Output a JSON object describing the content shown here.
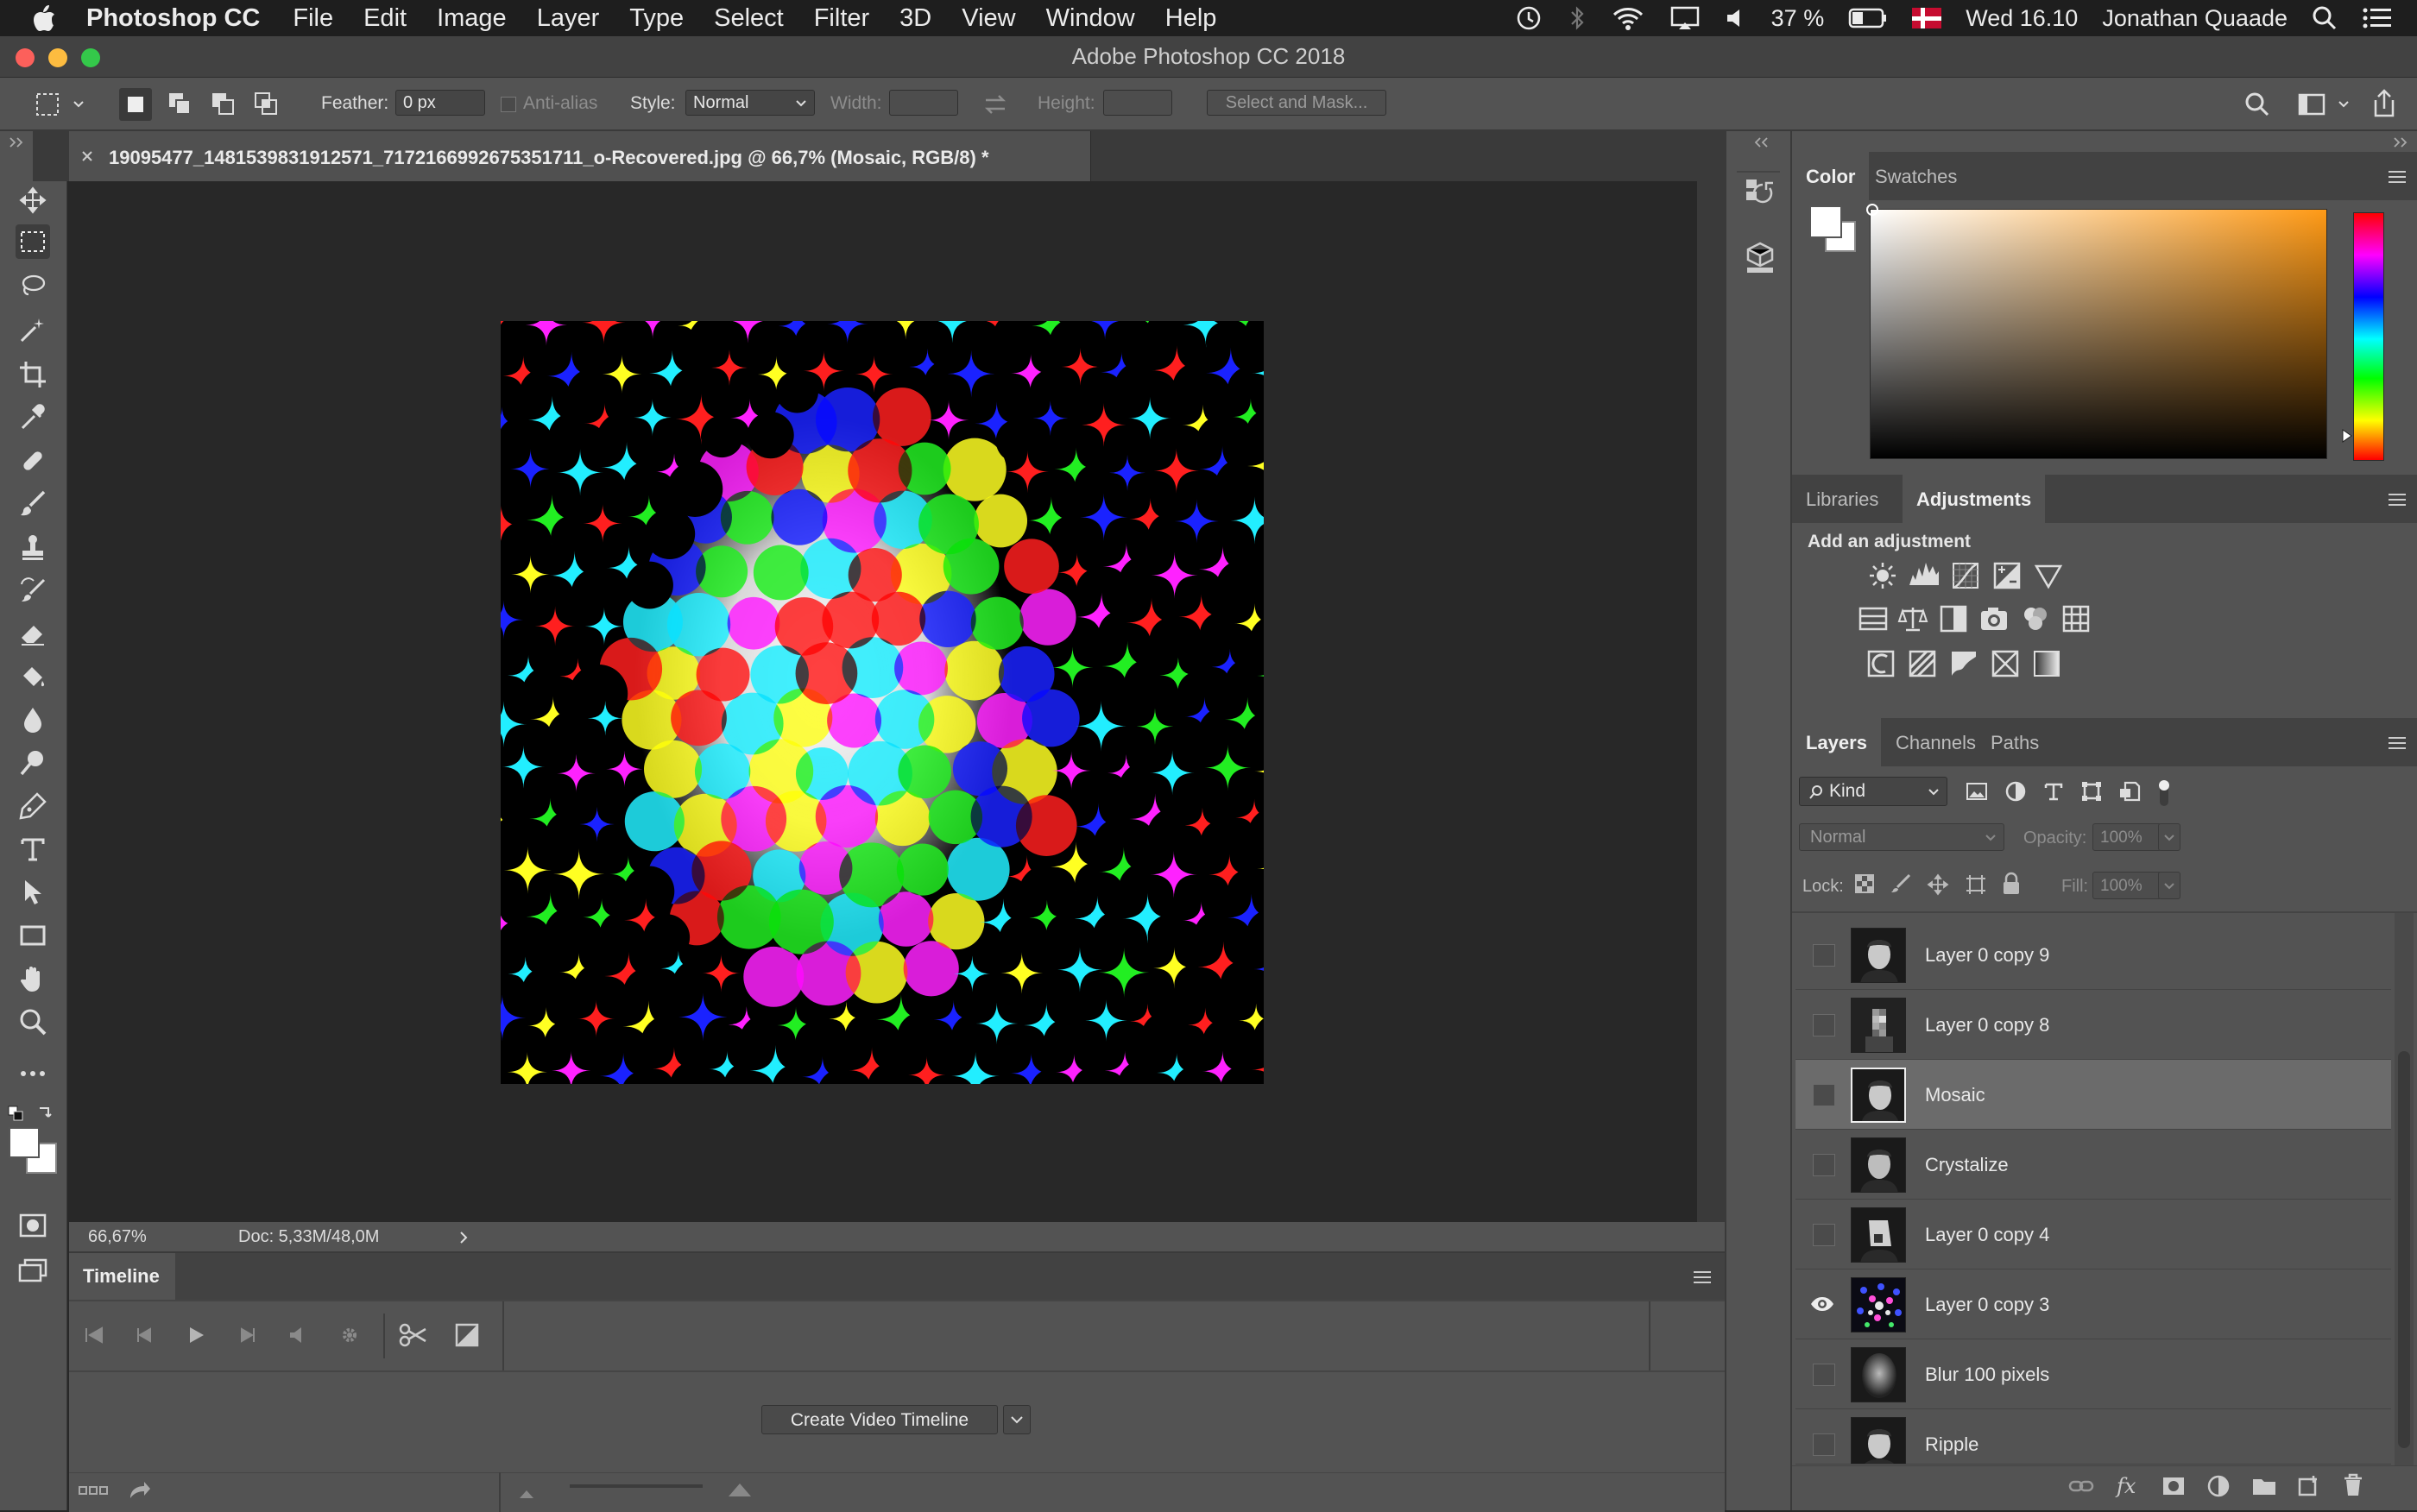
{
  "menubar": {
    "app_name": "Photoshop CC",
    "items": [
      "File",
      "Edit",
      "Image",
      "Layer",
      "Type",
      "Select",
      "Filter",
      "3D",
      "View",
      "Window",
      "Help"
    ],
    "battery": "37 %",
    "clock": "Wed 16.10",
    "user": "Jonathan Quaade"
  },
  "window": {
    "title": "Adobe Photoshop CC 2018"
  },
  "options_bar": {
    "feather_label": "Feather:",
    "feather_value": "0 px",
    "anti_alias_label": "Anti-alias",
    "style_label": "Style:",
    "style_value": "Normal",
    "width_label": "Width:",
    "height_label": "Height:",
    "select_mask_label": "Select and Mask..."
  },
  "document": {
    "tab_title": "19095477_1481539831912571_7172166992675351711_o-Recovered.jpg @ 66,7% (Mosaic, RGB/8) *",
    "zoom": "66,67%",
    "doc_size": "Doc: 5,33M/48,0M"
  },
  "timeline": {
    "tab_label": "Timeline",
    "create_button_label": "Create Video Timeline"
  },
  "color_panel": {
    "tabs": [
      "Color",
      "Swatches"
    ],
    "active_tab": "Color"
  },
  "adjustments_panel": {
    "tabs": [
      "Libraries",
      "Adjustments"
    ],
    "active_tab": "Adjustments",
    "heading": "Add an adjustment"
  },
  "layers_panel": {
    "tabs": [
      "Layers",
      "Channels",
      "Paths"
    ],
    "active_tab": "Layers",
    "filter_kind": "Kind",
    "blend_mode": "Normal",
    "opacity_label": "Opacity:",
    "opacity_value": "100%",
    "lock_label": "Lock:",
    "fill_label": "Fill:",
    "fill_value": "100%",
    "layers": [
      {
        "name": "Layer 0 copy 9",
        "visible": false,
        "selected": false
      },
      {
        "name": "Layer 0 copy 8",
        "visible": false,
        "selected": false
      },
      {
        "name": "Mosaic",
        "visible": false,
        "selected": true
      },
      {
        "name": "Crystalize",
        "visible": false,
        "selected": false
      },
      {
        "name": "Layer 0 copy 4",
        "visible": false,
        "selected": false
      },
      {
        "name": "Layer 0 copy 3",
        "visible": true,
        "selected": false
      },
      {
        "name": "Blur 100 pixels",
        "visible": false,
        "selected": false
      },
      {
        "name": "Ripple",
        "visible": false,
        "selected": false
      }
    ]
  },
  "colors": {
    "ui_dark": "#282828",
    "panel": "#535353",
    "selected_layer": "#6b6b6b",
    "art_red": "#ff1f1f",
    "art_green": "#22ee22",
    "art_blue": "#1a22ff",
    "art_magenta": "#ff22ff",
    "art_cyan": "#22eeff",
    "art_yellow": "#ffff22"
  }
}
